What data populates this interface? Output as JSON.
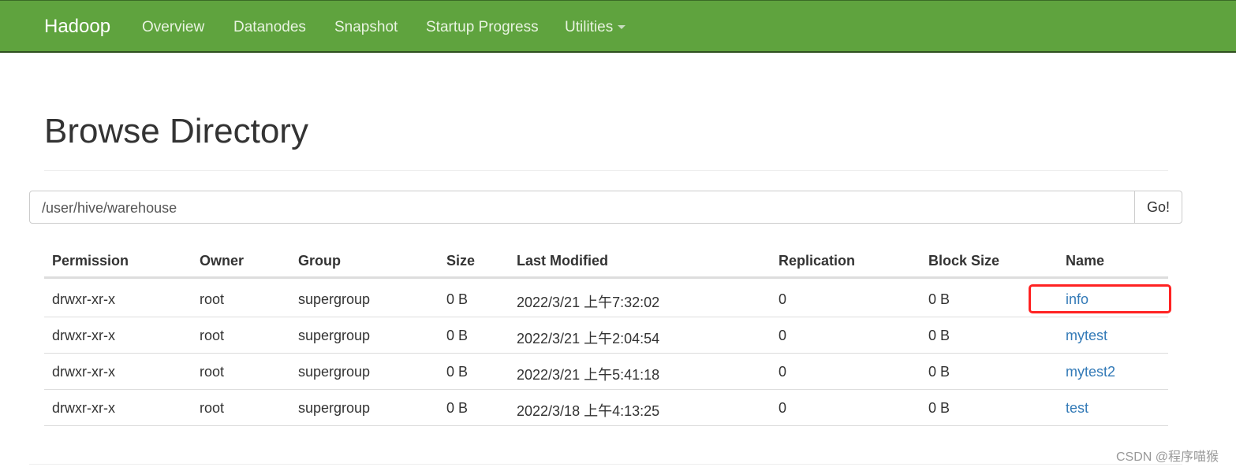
{
  "navbar": {
    "brand": "Hadoop",
    "items": [
      "Overview",
      "Datanodes",
      "Snapshot",
      "Startup Progress",
      "Utilities"
    ],
    "color": "#5fa33e"
  },
  "page_title": "Browse Directory",
  "path_input": {
    "value": "/user/hive/warehouse"
  },
  "go_label": "Go!",
  "table": {
    "headers": [
      "Permission",
      "Owner",
      "Group",
      "Size",
      "Last Modified",
      "Replication",
      "Block Size",
      "Name"
    ],
    "rows": [
      [
        "drwxr-xr-x",
        "root",
        "supergroup",
        "0 B",
        "2022/3/21 上午7:32:02",
        "0",
        "0 B",
        "info"
      ],
      [
        "drwxr-xr-x",
        "root",
        "supergroup",
        "0 B",
        "2022/3/21 上午2:04:54",
        "0",
        "0 B",
        "mytest"
      ],
      [
        "drwxr-xr-x",
        "root",
        "supergroup",
        "0 B",
        "2022/3/21 上午5:41:18",
        "0",
        "0 B",
        "mytest2"
      ],
      [
        "drwxr-xr-x",
        "root",
        "supergroup",
        "0 B",
        "2022/3/18 上午4:13:25",
        "0",
        "0 B",
        "test"
      ]
    ]
  },
  "watermark": "CSDN @程序喵猴"
}
